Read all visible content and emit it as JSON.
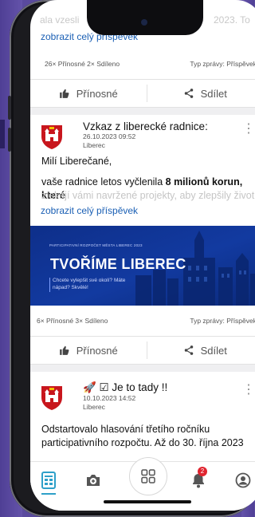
{
  "post_prev": {
    "faded_header": "ala vzesli",
    "faded_right": "2023. To",
    "show_full": "zobrazit celý příspěvek",
    "stats_left": "26× Přínosné  2× Sdíleno",
    "stats_right": "Typ zprávy: Příspěvek"
  },
  "actions": {
    "useful": "Přínosné",
    "share": "Sdílet"
  },
  "post1": {
    "title": "Vzkaz z liberecké radnice:",
    "date": "26.10.2023 09:52",
    "place": "Liberec",
    "greeting": "Milí Liberečané,",
    "body_start": "vaše radnice letos vyčlenila ",
    "body_bold": "8 milionů korun, které",
    "body_faded": "získají vámi navržené projekty, aby zlepšily život",
    "show_full": "zobrazit celý příspěvek",
    "stats_left": "6× Přínosné  3× Sdíleno",
    "stats_right": "Typ zprávy: Příspěvek",
    "banner": {
      "small": "PARTICIPATIVNÍ ROZPOČET MĚSTA LIBEREC 2023",
      "title": "TVOŘÍME LIBEREC",
      "sub_line1": "Chcete vylepšit své okolí? Máte",
      "sub_line2": "nápad? Skvělé!"
    }
  },
  "post2": {
    "title": "🚀 ☑ Je to tady !!",
    "date": "10.10.2023 14:52",
    "place": "Liberec",
    "body_line1": "Odstartovalo hlasování třetího ročníku",
    "body_line2": "participativního rozpočtu. Až do 30. října 2023"
  },
  "tabbar": {
    "notification_count": "2",
    "icons": [
      "feed-icon",
      "camera-plus-icon",
      "grid-icon",
      "bell-icon",
      "profile-icon"
    ]
  },
  "colors": {
    "link": "#1a5fb4",
    "accent": "#2ea0c9",
    "badge": "#e0242f",
    "banner": "#123aa0"
  }
}
